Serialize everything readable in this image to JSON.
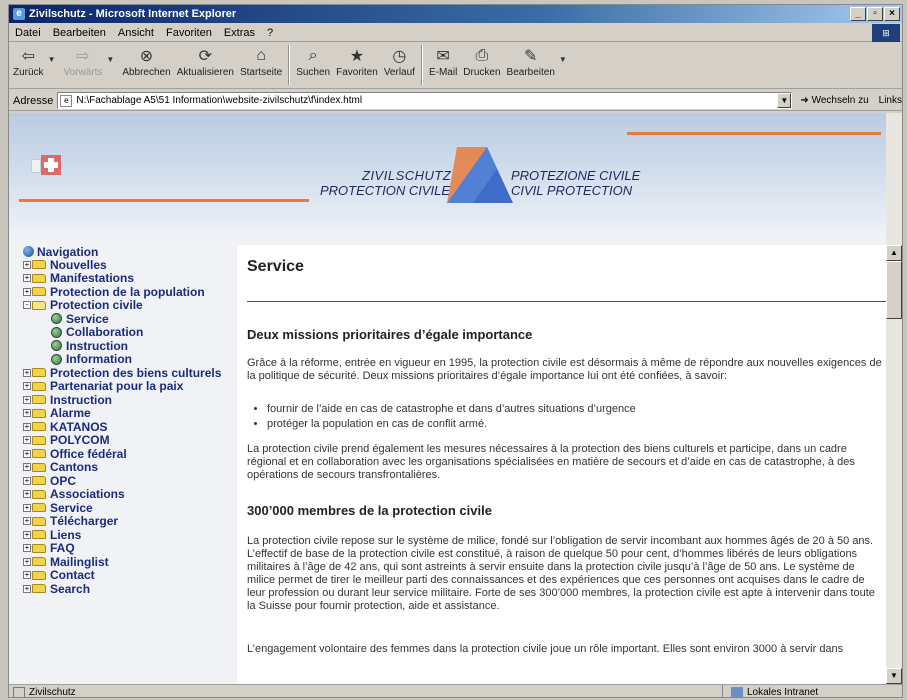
{
  "window": {
    "title": "Zivilschutz - Microsoft Internet Explorer",
    "ie_glyph": "e"
  },
  "title_buttons": {
    "minimize": "_",
    "maximize": "▫",
    "close": "×"
  },
  "menu": [
    "Datei",
    "Bearbeiten",
    "Ansicht",
    "Favoriten",
    "Extras",
    "?"
  ],
  "toolbar": {
    "back": "Zurück",
    "forward": "Vorwärts",
    "stop": "Abbrechen",
    "refresh": "Aktualisieren",
    "home": "Startseite",
    "search": "Suchen",
    "favorites": "Favoriten",
    "history": "Verlauf",
    "mail": "E-Mail",
    "print": "Drucken",
    "edit": "Bearbeiten"
  },
  "address": {
    "label": "Adresse",
    "value": "N:\\Fachablage A5\\51 Information\\website-zivilschutz\\f\\index.html",
    "go": "Wechseln zu",
    "links": "Links"
  },
  "header": {
    "logo_de": "ZIVILSCHUTZ",
    "logo_fr": "PROTECTION CIVILE",
    "logo_it": "PROTEZIONE CIVILE",
    "logo_en": "CIVIL PROTECTION",
    "colors": {
      "orange_line": "#e67b3c",
      "triangle": "#3f6cc8"
    }
  },
  "nav": {
    "heading": "Navigation",
    "items": [
      {
        "label": "Nouvelles",
        "state": "+"
      },
      {
        "label": "Manifestations",
        "state": "+"
      },
      {
        "label": "Protection de la population",
        "state": "+"
      },
      {
        "label": "Protection civile",
        "state": "-"
      },
      {
        "label": "Service",
        "sub": true
      },
      {
        "label": "Collaboration",
        "sub": true
      },
      {
        "label": "Instruction",
        "sub": true
      },
      {
        "label": "Information",
        "sub": true
      },
      {
        "label": "Protection des biens culturels",
        "state": "+"
      },
      {
        "label": "Partenariat pour la paix",
        "state": "+"
      },
      {
        "label": "Instruction",
        "state": "+"
      },
      {
        "label": "Alarme",
        "state": "+"
      },
      {
        "label": "KATANOS",
        "state": "+"
      },
      {
        "label": "POLYCOM",
        "state": "+"
      },
      {
        "label": "Office fédéral",
        "state": "+"
      },
      {
        "label": "Cantons",
        "state": "+"
      },
      {
        "label": "OPC",
        "state": "+"
      },
      {
        "label": "Associations",
        "state": "+"
      },
      {
        "label": "Service",
        "state": "+"
      },
      {
        "label": "Télécharger",
        "state": "+"
      },
      {
        "label": "Liens",
        "state": "+"
      },
      {
        "label": "FAQ",
        "state": "+"
      },
      {
        "label": "Mailinglist",
        "state": "+"
      },
      {
        "label": "Contact",
        "state": "+"
      },
      {
        "label": "Search",
        "state": "+"
      }
    ]
  },
  "main": {
    "title": "Service",
    "h1": "Deux missions prioritaires d’égale importance",
    "p1": "Grâce à la réforme, entrée en vigueur en 1995, la protection civile est désormais à même de répondre aux nouvelles exigences de la politique de sécurité. Deux missions prioritaires d’égale importance lui ont été confiées, à savoir:",
    "bullets": [
      "fournir de l’aide en cas de catastrophe et dans d’autres situations d’urgence",
      "protéger la population en cas de conflit armé."
    ],
    "p2": "La protection civile prend également les mesures nécessaires à la protection des biens culturels et participe, dans un cadre régional et en collaboration avec les organisations spécialisées en matière de secours et d’aide en cas de catastrophe, à des opérations de secours transfrontalières.",
    "h2": "300’000 membres de la protection civile",
    "p3": "La protection civile repose sur le système de milice, fondé sur l’obligation de servir incombant aux hommes âgés de 20 à 50 ans. L’effectif de base de la protection civile est constitué, à raison de quelque 50 pour cent, d’hommes libérés de leurs obligations militaires à l’âge de 42 ans, qui sont astreints à servir ensuite dans la protection civile jusqu’à l’âge de 50 ans. Le système de milice permet de tirer le meilleur parti des connaissances et des expériences que ces personnes ont acquises dans le cadre de leur profession ou durant leur service militaire. Forte de ses 300’000 membres, la protection civile est apte à intervenir dans toute la Suisse pour fournir protection, aide et assistance.",
    "p4": "L’engagement volontaire des femmes dans la protection civile joue un rôle important. Elles sont environ 3000 à servir dans"
  },
  "status": {
    "left": "Zivilschutz",
    "zone": "Lokales Intranet"
  }
}
